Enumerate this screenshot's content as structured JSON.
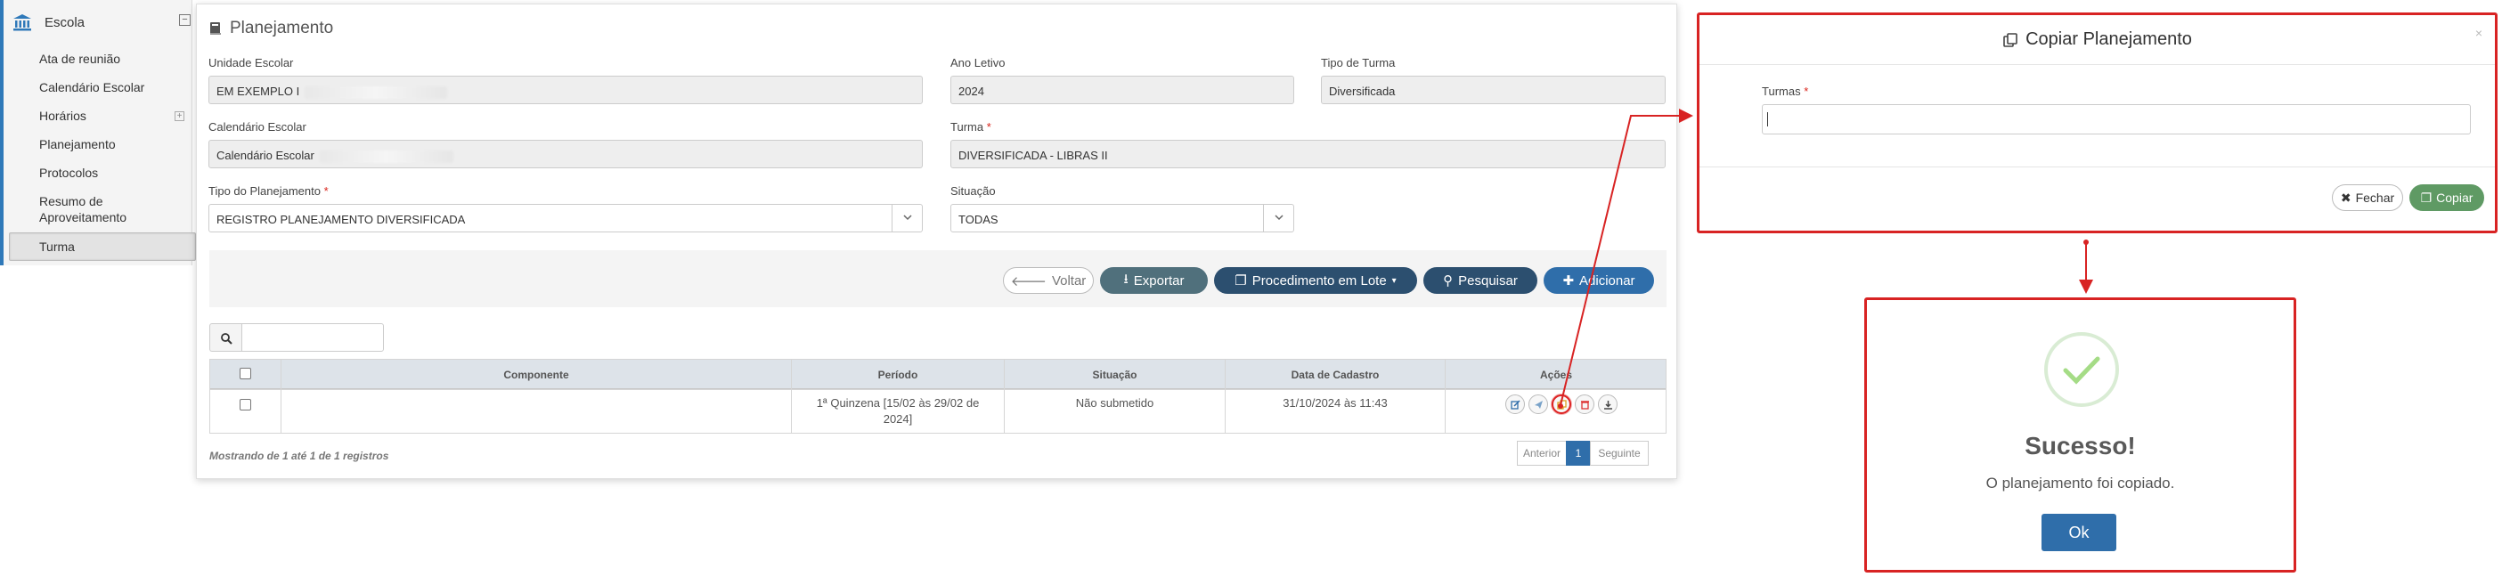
{
  "sidebar": {
    "title": "Escola",
    "items": [
      {
        "label": "Ata de reunião"
      },
      {
        "label": "Calendário Escolar"
      },
      {
        "label": "Horários"
      },
      {
        "label": "Planejamento"
      },
      {
        "label": "Protocolos"
      },
      {
        "label": "Resumo de"
      },
      {
        "label": "Aproveitamento"
      },
      {
        "label": "Turma"
      }
    ]
  },
  "panel": {
    "title": "Planejamento",
    "fields": {
      "unidade_label": "Unidade Escolar",
      "unidade_value": "EM EXEMPLO I",
      "ano_label": "Ano Letivo",
      "ano_value": "2024",
      "tipo_turma_label": "Tipo de Turma",
      "tipo_turma_value": "Diversificada",
      "calendario_label": "Calendário Escolar",
      "calendario_value": "Calendário Escolar",
      "turma_label": "Turma",
      "turma_value": "DIVERSIFICADA - LIBRAS II",
      "tipo_plan_label": "Tipo do Planejamento",
      "tipo_plan_value": "REGISTRO PLANEJAMENTO DIVERSIFICADA",
      "situacao_label": "Situação",
      "situacao_value": "TODAS",
      "required_mark": "*"
    },
    "buttons": {
      "voltar": "Voltar",
      "exportar": "Exportar",
      "lote": "Procedimento em Lote",
      "pesquisar": "Pesquisar",
      "adicionar": "Adicionar"
    },
    "table": {
      "headers": {
        "componente": "Componente",
        "periodo": "Período",
        "situacao": "Situação",
        "data": "Data de Cadastro",
        "acoes": "Ações"
      },
      "row": {
        "componente": "",
        "periodo_line1": "1ª Quinzena [15/02 às 29/02 de",
        "periodo_line2": "2024]",
        "situacao": "Não submetido",
        "data": "31/10/2024 às 11:43"
      }
    },
    "footer": {
      "summary": "Mostrando de 1 até 1 de 1 registros",
      "prev": "Anterior",
      "page": "1",
      "next": "Seguinte"
    }
  },
  "copy_modal": {
    "title": "Copiar Planejamento",
    "close": "×",
    "turmas_label": "Turmas",
    "turmas_value": "",
    "fechar": "Fechar",
    "copiar": "Copiar"
  },
  "success_modal": {
    "title": "Sucesso!",
    "message": "O planejamento foi copiado.",
    "ok": "Ok"
  },
  "colors": {
    "primary": "#2f6eaa",
    "success_green": "#5f9a64",
    "highlight_red": "#d82323"
  }
}
